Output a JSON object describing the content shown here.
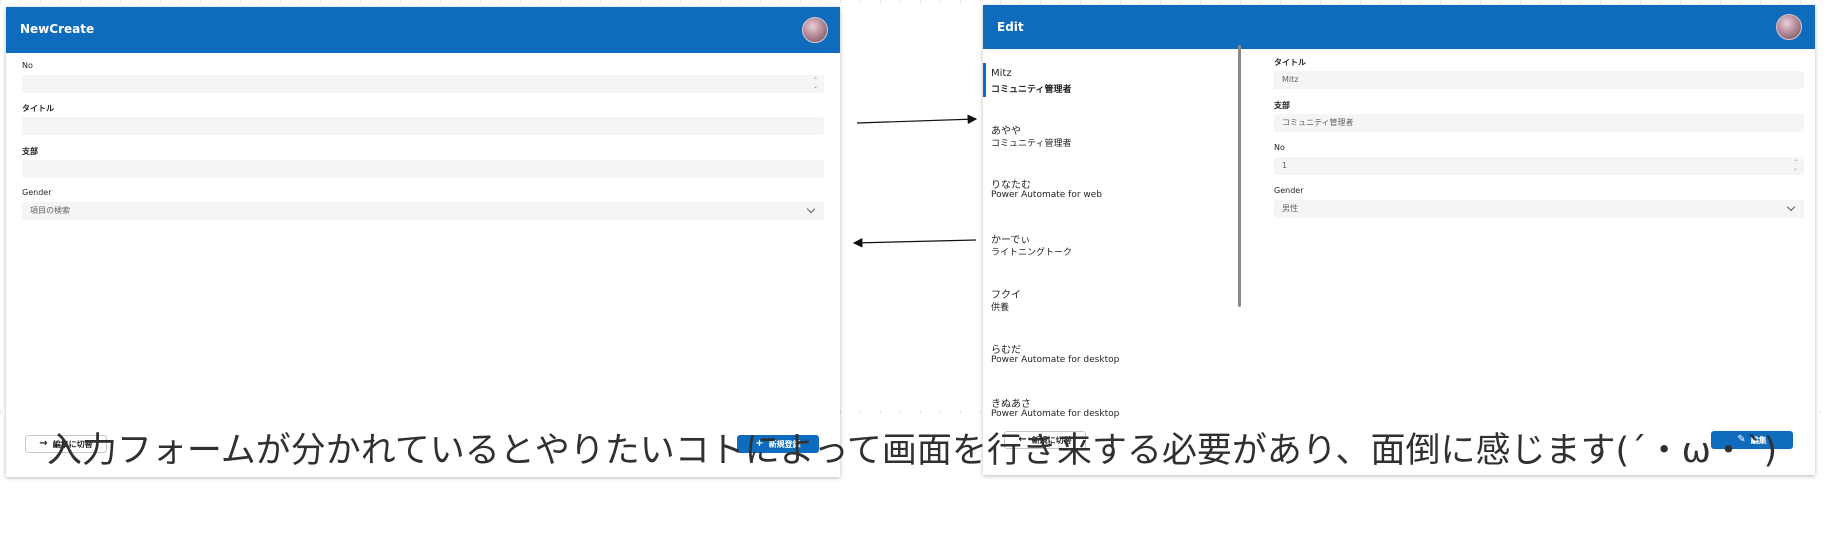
{
  "left_panel": {
    "title": "NewCreate",
    "fields": {
      "no_label": "No",
      "title_label": "タイトル",
      "branch_label": "支部",
      "gender_label": "Gender",
      "gender_placeholder": "項目の検索"
    },
    "buttons": {
      "switch_to_edit": "編集に切替",
      "new_register": "新規登録"
    }
  },
  "right_panel": {
    "title": "Edit",
    "gallery": [
      {
        "name": "Mitz",
        "sub": "コミュニティ管理者"
      },
      {
        "name": "あやや",
        "sub": "コミュニティ管理者"
      },
      {
        "name": "りなたむ",
        "sub": "Power Automate for web"
      },
      {
        "name": "かーでぃ",
        "sub": "ライトニングトーク"
      },
      {
        "name": "フクイ",
        "sub": "供養"
      },
      {
        "name": "らむだ",
        "sub": "Power Automate for desktop"
      },
      {
        "name": "きぬあさ",
        "sub": "Power Automate for desktop"
      }
    ],
    "form": {
      "title_label": "タイトル",
      "title_value": "Mitz",
      "branch_label": "支部",
      "branch_value": "コミュニティ管理者",
      "no_label": "No",
      "no_value": "1",
      "gender_label": "Gender",
      "gender_value": "男性"
    },
    "buttons": {
      "switch_to_new": "新規に切替",
      "edit": "編集"
    }
  },
  "caption": "入力フォームが分かれているとやりたいコトによって画面を行き来する必要があり、面倒に感じます(´・ω・`)",
  "colors": {
    "header": "#0f6cbd",
    "primary_button": "#0f6cbd"
  },
  "icons": {
    "arrow_right": "→",
    "arrow_left": "←",
    "plus": "+",
    "pencil": "✎"
  }
}
